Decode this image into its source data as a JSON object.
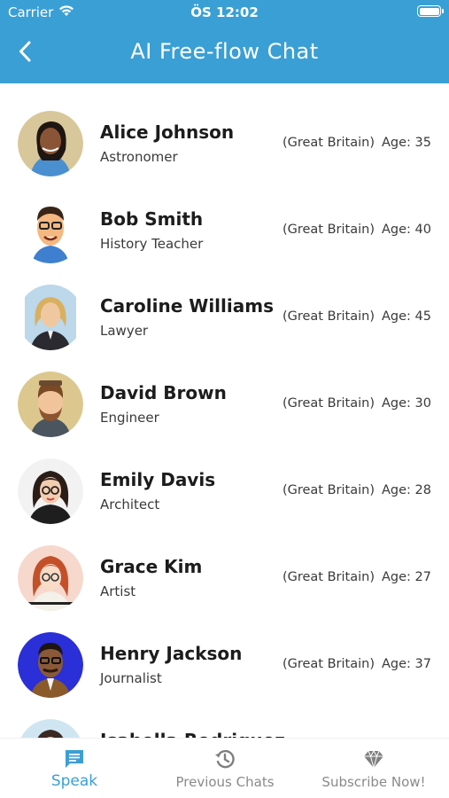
{
  "status_bar": {
    "carrier": "Carrier",
    "time": "ÖS 12:02"
  },
  "header": {
    "title": "AI Free-flow Chat",
    "back_icon": "chevron-left-icon"
  },
  "contacts": [
    {
      "name": "Alice Johnson",
      "job": "Astronomer",
      "country": "(Great Britain)",
      "age": "Age: 35"
    },
    {
      "name": "Bob Smith",
      "job": "History Teacher",
      "country": "(Great Britain)",
      "age": "Age: 40"
    },
    {
      "name": "Caroline Williams",
      "job": "Lawyer",
      "country": "(Great Britain)",
      "age": "Age: 45"
    },
    {
      "name": "David Brown",
      "job": "Engineer",
      "country": "(Great Britain)",
      "age": "Age: 30"
    },
    {
      "name": "Emily Davis",
      "job": "Architect",
      "country": "(Great Britain)",
      "age": "Age: 28"
    },
    {
      "name": "Grace Kim",
      "job": "Artist",
      "country": "(Great Britain)",
      "age": "Age: 27"
    },
    {
      "name": "Henry Jackson",
      "job": "Journalist",
      "country": "(Great Britain)",
      "age": "Age: 37"
    },
    {
      "name": "Isabella Rodriguez",
      "job": "",
      "country": "",
      "age": ""
    }
  ],
  "tabs": [
    {
      "label": "Speak",
      "icon": "chat-bubble-icon",
      "active": true
    },
    {
      "label": "Previous Chats",
      "icon": "history-icon",
      "active": false
    },
    {
      "label": "Subscribe Now!",
      "icon": "diamond-icon",
      "active": false
    }
  ],
  "colors": {
    "accent": "#3a9fd5",
    "inactive": "#8a8a8a"
  }
}
